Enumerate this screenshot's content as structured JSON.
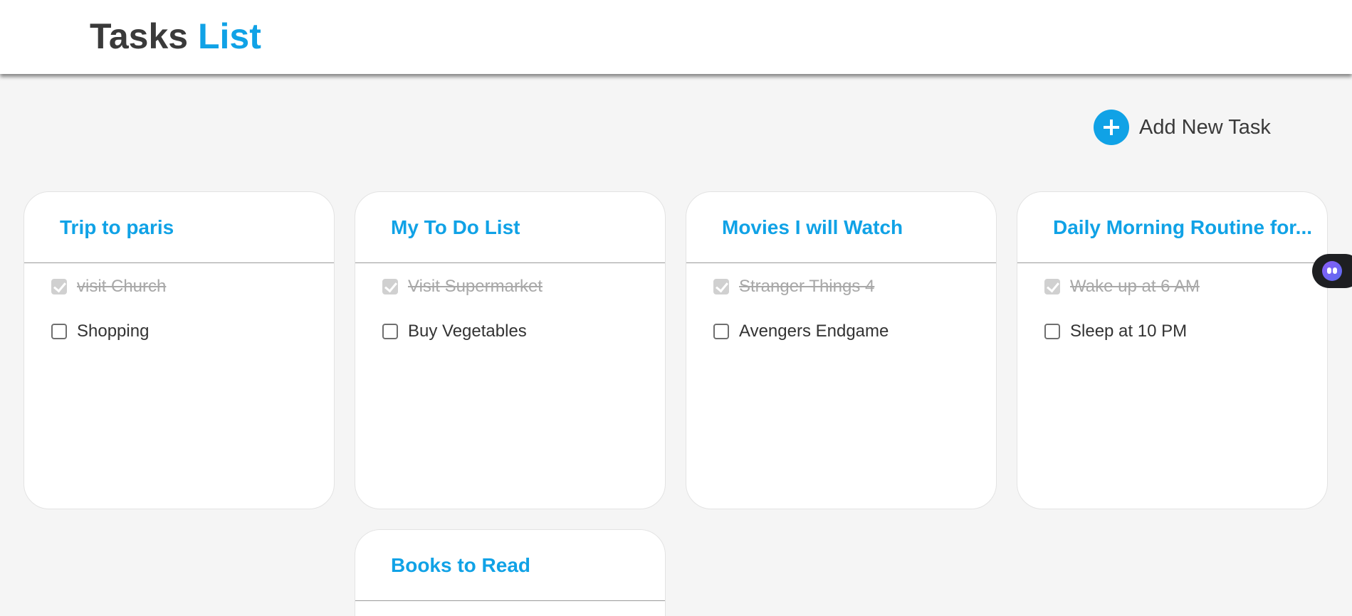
{
  "header": {
    "brand_part1": "Tasks",
    "brand_part2": "List"
  },
  "actions": {
    "add_task_label": "Add New Task"
  },
  "colors": {
    "accent": "#10a2e6",
    "text": "#3a3a3a",
    "background": "#f5f5f5",
    "done_text": "#a8a8a8"
  },
  "lists": [
    {
      "title": "Trip to paris",
      "tasks": [
        {
          "text": "visit Church",
          "done": true
        },
        {
          "text": "Shopping",
          "done": false
        }
      ]
    },
    {
      "title": "My To Do List",
      "tasks": [
        {
          "text": "Visit Supermarket",
          "done": true
        },
        {
          "text": "Buy Vegetables",
          "done": false
        }
      ]
    },
    {
      "title": "Movies I will Watch",
      "tasks": [
        {
          "text": "Stranger Things 4",
          "done": true
        },
        {
          "text": "Avengers Endgame",
          "done": false
        }
      ]
    },
    {
      "title": "Daily Morning Routine for...",
      "tasks": [
        {
          "text": "Wake up at 6 AM",
          "done": true
        },
        {
          "text": "Sleep at 10 PM",
          "done": false
        }
      ]
    },
    {
      "title": "Books to Read",
      "tasks": []
    }
  ],
  "side_widget": {
    "icon": "assistant-face-icon"
  }
}
